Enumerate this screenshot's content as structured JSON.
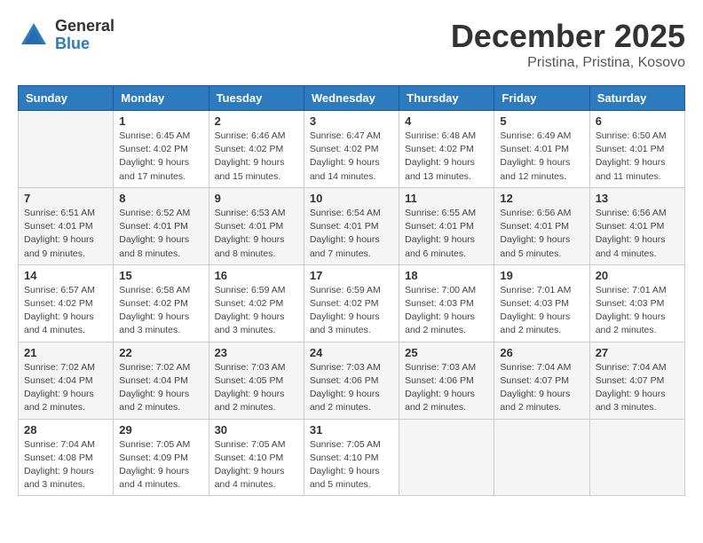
{
  "logo": {
    "general": "General",
    "blue": "Blue"
  },
  "title": "December 2025",
  "subtitle": "Pristina, Pristina, Kosovo",
  "days_of_week": [
    "Sunday",
    "Monday",
    "Tuesday",
    "Wednesday",
    "Thursday",
    "Friday",
    "Saturday"
  ],
  "weeks": [
    [
      {
        "day": "",
        "info": ""
      },
      {
        "day": "1",
        "info": "Sunrise: 6:45 AM\nSunset: 4:02 PM\nDaylight: 9 hours\nand 17 minutes."
      },
      {
        "day": "2",
        "info": "Sunrise: 6:46 AM\nSunset: 4:02 PM\nDaylight: 9 hours\nand 15 minutes."
      },
      {
        "day": "3",
        "info": "Sunrise: 6:47 AM\nSunset: 4:02 PM\nDaylight: 9 hours\nand 14 minutes."
      },
      {
        "day": "4",
        "info": "Sunrise: 6:48 AM\nSunset: 4:02 PM\nDaylight: 9 hours\nand 13 minutes."
      },
      {
        "day": "5",
        "info": "Sunrise: 6:49 AM\nSunset: 4:01 PM\nDaylight: 9 hours\nand 12 minutes."
      },
      {
        "day": "6",
        "info": "Sunrise: 6:50 AM\nSunset: 4:01 PM\nDaylight: 9 hours\nand 11 minutes."
      }
    ],
    [
      {
        "day": "7",
        "info": "Sunrise: 6:51 AM\nSunset: 4:01 PM\nDaylight: 9 hours\nand 9 minutes."
      },
      {
        "day": "8",
        "info": "Sunrise: 6:52 AM\nSunset: 4:01 PM\nDaylight: 9 hours\nand 8 minutes."
      },
      {
        "day": "9",
        "info": "Sunrise: 6:53 AM\nSunset: 4:01 PM\nDaylight: 9 hours\nand 8 minutes."
      },
      {
        "day": "10",
        "info": "Sunrise: 6:54 AM\nSunset: 4:01 PM\nDaylight: 9 hours\nand 7 minutes."
      },
      {
        "day": "11",
        "info": "Sunrise: 6:55 AM\nSunset: 4:01 PM\nDaylight: 9 hours\nand 6 minutes."
      },
      {
        "day": "12",
        "info": "Sunrise: 6:56 AM\nSunset: 4:01 PM\nDaylight: 9 hours\nand 5 minutes."
      },
      {
        "day": "13",
        "info": "Sunrise: 6:56 AM\nSunset: 4:01 PM\nDaylight: 9 hours\nand 4 minutes."
      }
    ],
    [
      {
        "day": "14",
        "info": "Sunrise: 6:57 AM\nSunset: 4:02 PM\nDaylight: 9 hours\nand 4 minutes."
      },
      {
        "day": "15",
        "info": "Sunrise: 6:58 AM\nSunset: 4:02 PM\nDaylight: 9 hours\nand 3 minutes."
      },
      {
        "day": "16",
        "info": "Sunrise: 6:59 AM\nSunset: 4:02 PM\nDaylight: 9 hours\nand 3 minutes."
      },
      {
        "day": "17",
        "info": "Sunrise: 6:59 AM\nSunset: 4:02 PM\nDaylight: 9 hours\nand 3 minutes."
      },
      {
        "day": "18",
        "info": "Sunrise: 7:00 AM\nSunset: 4:03 PM\nDaylight: 9 hours\nand 2 minutes."
      },
      {
        "day": "19",
        "info": "Sunrise: 7:01 AM\nSunset: 4:03 PM\nDaylight: 9 hours\nand 2 minutes."
      },
      {
        "day": "20",
        "info": "Sunrise: 7:01 AM\nSunset: 4:03 PM\nDaylight: 9 hours\nand 2 minutes."
      }
    ],
    [
      {
        "day": "21",
        "info": "Sunrise: 7:02 AM\nSunset: 4:04 PM\nDaylight: 9 hours\nand 2 minutes."
      },
      {
        "day": "22",
        "info": "Sunrise: 7:02 AM\nSunset: 4:04 PM\nDaylight: 9 hours\nand 2 minutes."
      },
      {
        "day": "23",
        "info": "Sunrise: 7:03 AM\nSunset: 4:05 PM\nDaylight: 9 hours\nand 2 minutes."
      },
      {
        "day": "24",
        "info": "Sunrise: 7:03 AM\nSunset: 4:06 PM\nDaylight: 9 hours\nand 2 minutes."
      },
      {
        "day": "25",
        "info": "Sunrise: 7:03 AM\nSunset: 4:06 PM\nDaylight: 9 hours\nand 2 minutes."
      },
      {
        "day": "26",
        "info": "Sunrise: 7:04 AM\nSunset: 4:07 PM\nDaylight: 9 hours\nand 2 minutes."
      },
      {
        "day": "27",
        "info": "Sunrise: 7:04 AM\nSunset: 4:07 PM\nDaylight: 9 hours\nand 3 minutes."
      }
    ],
    [
      {
        "day": "28",
        "info": "Sunrise: 7:04 AM\nSunset: 4:08 PM\nDaylight: 9 hours\nand 3 minutes."
      },
      {
        "day": "29",
        "info": "Sunrise: 7:05 AM\nSunset: 4:09 PM\nDaylight: 9 hours\nand 4 minutes."
      },
      {
        "day": "30",
        "info": "Sunrise: 7:05 AM\nSunset: 4:10 PM\nDaylight: 9 hours\nand 4 minutes."
      },
      {
        "day": "31",
        "info": "Sunrise: 7:05 AM\nSunset: 4:10 PM\nDaylight: 9 hours\nand 5 minutes."
      },
      {
        "day": "",
        "info": ""
      },
      {
        "day": "",
        "info": ""
      },
      {
        "day": "",
        "info": ""
      }
    ]
  ]
}
